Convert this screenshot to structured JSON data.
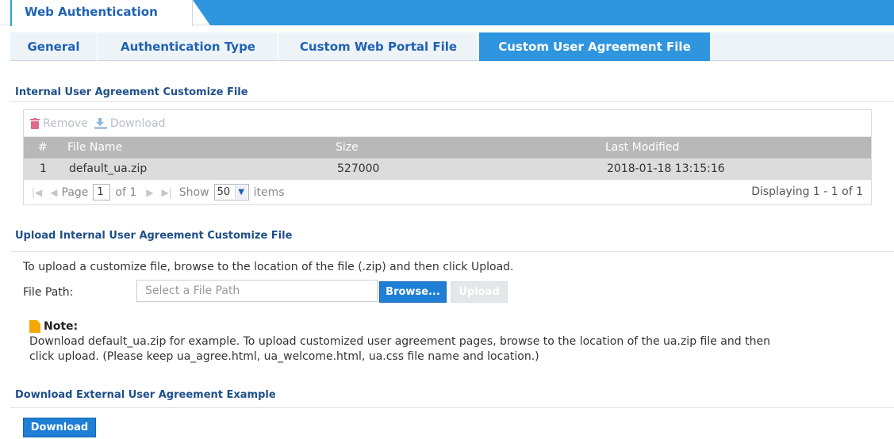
{
  "window": {
    "title": "Web Authentication"
  },
  "tabs": [
    {
      "label": "General",
      "active": false
    },
    {
      "label": "Authentication Type",
      "active": false
    },
    {
      "label": "Custom Web Portal File",
      "active": false
    },
    {
      "label": "Custom User Agreement File",
      "active": true
    }
  ],
  "internal_section": {
    "title": "Internal User Agreement Customize File",
    "toolbar": {
      "remove_label": "Remove",
      "download_label": "Download"
    },
    "columns": [
      "#",
      "File Name",
      "Size",
      "Last Modified"
    ],
    "rows": [
      {
        "index": "1",
        "file_name": "default_ua.zip",
        "size": "527000",
        "last_modified": "2018-01-18 13:15:16"
      }
    ],
    "pager": {
      "page_label": "Page",
      "page_value": "1",
      "of_label": "of 1",
      "show_label": "Show",
      "show_value": "50",
      "items_label": "items",
      "display_text": "Displaying 1 - 1 of 1"
    }
  },
  "upload_section": {
    "title": "Upload Internal User Agreement Customize File",
    "description": "To upload a customize file, browse to the location of the file (.zip) and then click Upload.",
    "file_path_label": "File Path:",
    "file_path_placeholder": "Select a File Path",
    "browse_label": "Browse...",
    "upload_label": "Upload"
  },
  "note": {
    "heading": "Note:",
    "line1": "Download default_ua.zip for example. To upload customized user agreement pages, browse to the location of the ua.zip file and then",
    "line2": "click upload. (Please keep ua_agree.html, ua_welcome.html, ua.css file name and location.)"
  },
  "external_section": {
    "title": "Download External User Agreement Example",
    "download_label": "Download"
  },
  "colors": {
    "accent": "#2f95de",
    "title_text": "#1f62b4",
    "button": "#1f7fd6",
    "header_gray": "#b8b8b8",
    "row_gray": "#dcdcdc"
  },
  "icons": {
    "remove": "trash-icon",
    "download": "download-icon",
    "note": "note-icon"
  }
}
